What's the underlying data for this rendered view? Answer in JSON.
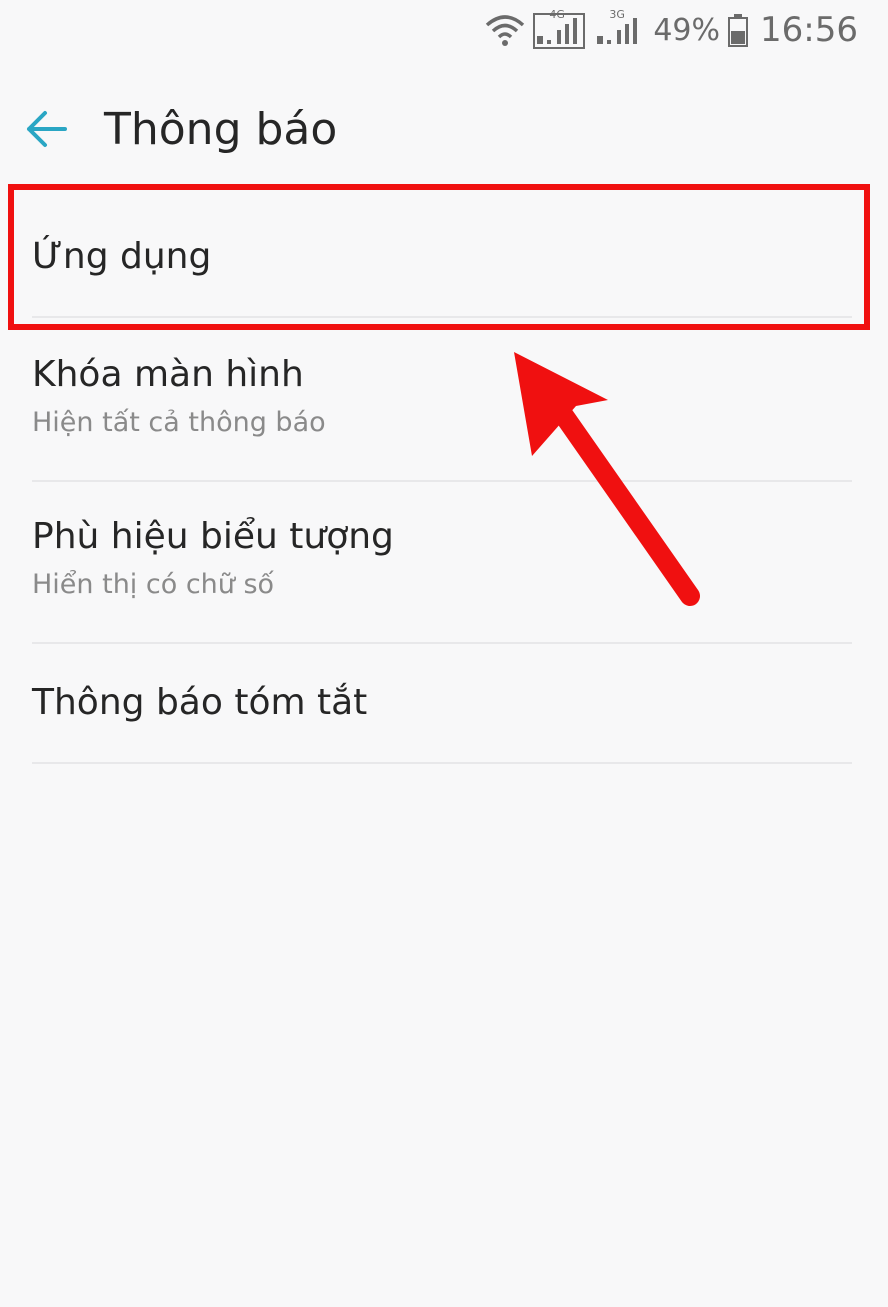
{
  "status_bar": {
    "icons": [
      "wifi-icon",
      "signal-4g-icon",
      "signal-3g-icon",
      "battery-icon"
    ],
    "net_label_1": "4G",
    "net_label_2": "3G",
    "battery": "49%",
    "time": "16:56"
  },
  "header": {
    "back_icon": "arrow-left-icon",
    "title": "Thông báo"
  },
  "list": {
    "items": [
      {
        "title": "Ứng dụng",
        "subtitle": ""
      },
      {
        "title": "Khóa màn hình",
        "subtitle": "Hiện tất cả thông báo"
      },
      {
        "title": "Phù hiệu biểu tượng",
        "subtitle": "Hiển thị có chữ số"
      },
      {
        "title": "Thông báo tóm tắt",
        "subtitle": ""
      }
    ]
  },
  "colors": {
    "background": "#f8f8f9",
    "accent": "#2aa6c4",
    "text_primary": "#262626",
    "text_secondary": "#8a8a8a",
    "annotation": "#f01010"
  }
}
